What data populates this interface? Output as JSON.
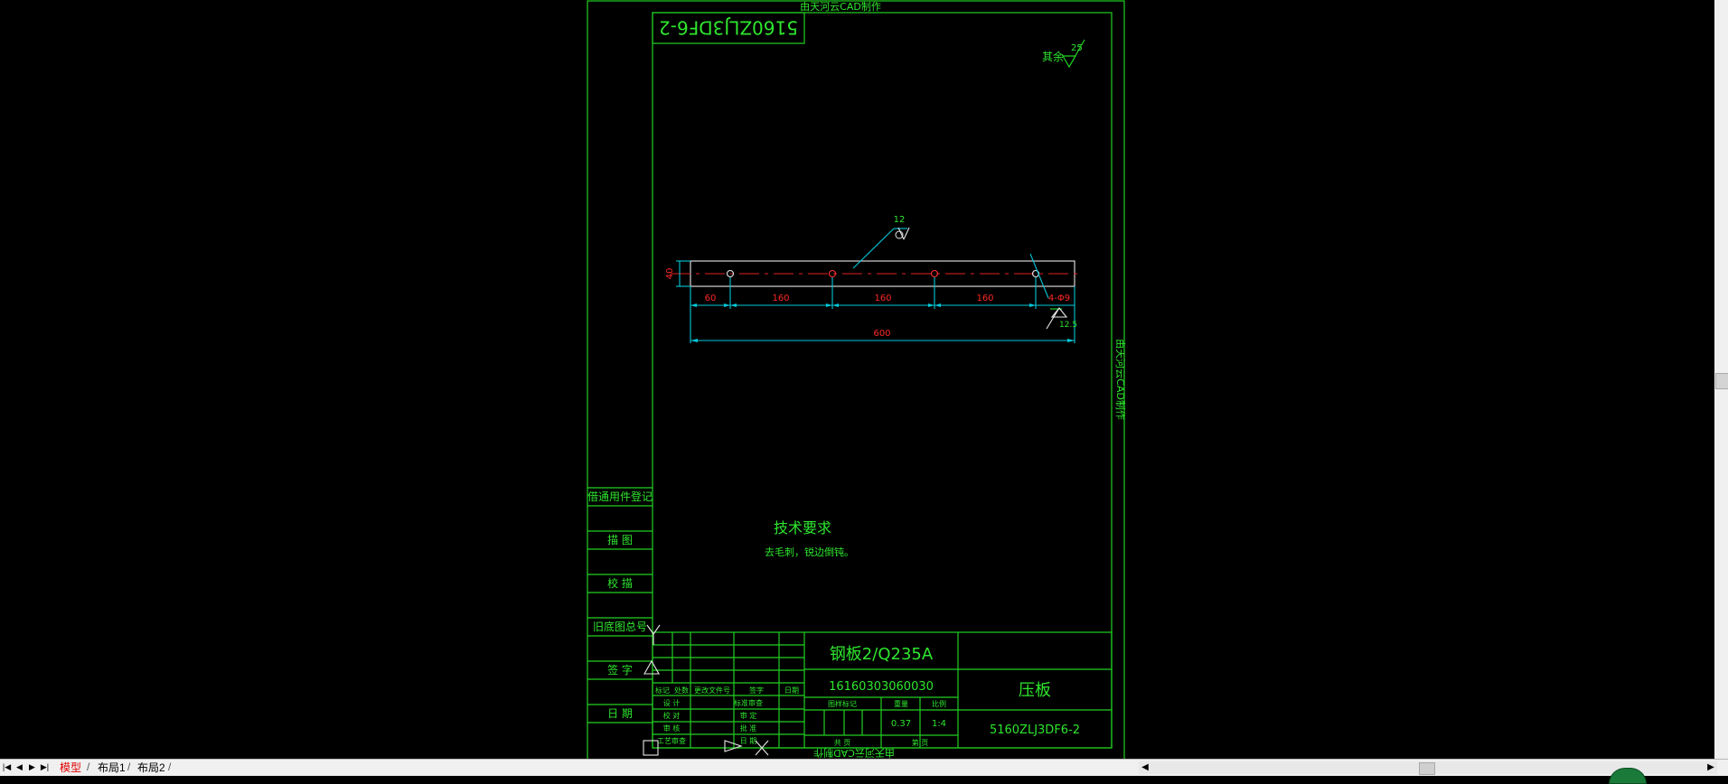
{
  "watermark": "由天河云CAD制作",
  "drawing_code": "5160ZLJ3DF6-2",
  "roughness": {
    "other_label": "其余",
    "other_value": "25",
    "face_value": "12",
    "hole_value": "12.5"
  },
  "dims": {
    "d60": "60",
    "d160a": "160",
    "d160b": "160",
    "d160c": "160",
    "d600": "600",
    "holes": "4-Φ9",
    "height": "40"
  },
  "tech": {
    "title": "技术要求",
    "note": "去毛刺，锐边倒钝。"
  },
  "side_labels": [
    "借通用件登记",
    "描  图",
    "校  描",
    "旧底图总号",
    "签  字",
    "日  期"
  ],
  "title_block": {
    "material": "钢板2/Q235A",
    "number": "16160303060030",
    "name": "压板",
    "code": "5160ZLJ3DF6-2",
    "weight": "0.37",
    "scale": "1:4",
    "headers": {
      "stage": "图样标记",
      "weight": "重量",
      "scale": "比例",
      "sheets_total": "共  页",
      "sheet": "第  页"
    },
    "rev_headers": [
      "标记",
      "处数",
      "更改文件号",
      "签字",
      "日期"
    ],
    "roles_left": [
      "设  计",
      "校  对",
      "审  核",
      "工艺审查"
    ],
    "roles_right": [
      "标准审查",
      "审  定",
      "批  准",
      "日  期"
    ]
  },
  "tabs": {
    "model": "模型",
    "layout1": "布局1",
    "layout2": "布局2"
  },
  "colors": {
    "frame": "#22d022",
    "dimension": "#00c8d8",
    "center": "#e02020",
    "background": "#000000"
  }
}
